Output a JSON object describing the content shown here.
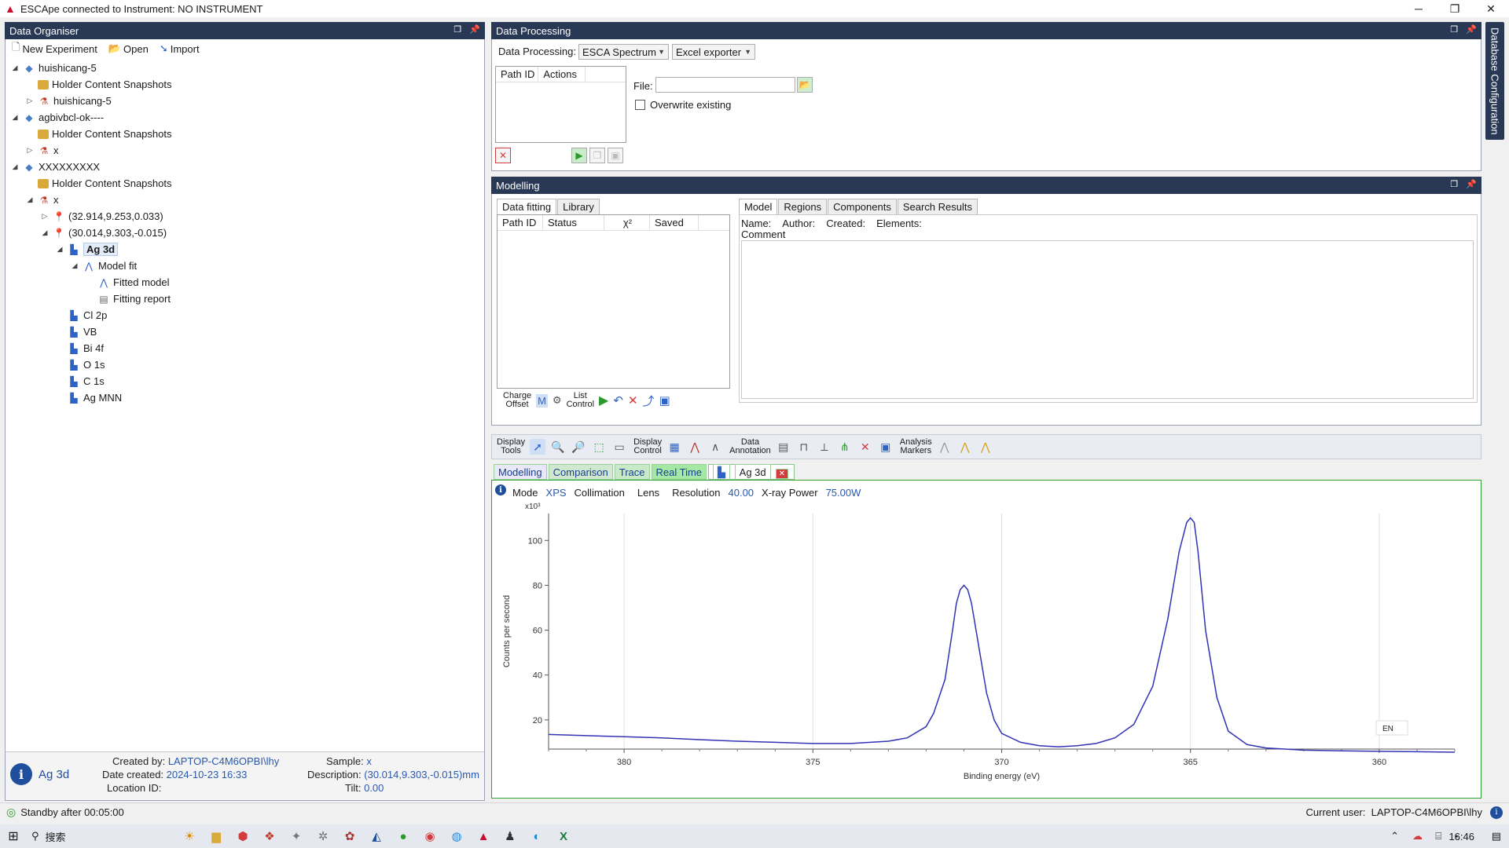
{
  "window": {
    "title": "ESCApe connected to Instrument: NO INSTRUMENT",
    "controls": [
      "minimize-icon",
      "restore-icon",
      "close-icon"
    ]
  },
  "organiser": {
    "title": "Data Organiser",
    "toolbar": {
      "new_experiment": "New Experiment",
      "open": "Open",
      "import": "Import"
    },
    "tree": [
      {
        "label": "huishicang-5",
        "level": 0,
        "toggle": "expanded",
        "icon": "experiment-icon"
      },
      {
        "label": "Holder Content Snapshots",
        "level": 1,
        "toggle": "none",
        "icon": "folder-icon"
      },
      {
        "label": "huishicang-5",
        "level": 1,
        "toggle": "collapsed",
        "icon": "sample-icon"
      },
      {
        "label": "agbivbcl-ok----",
        "level": 0,
        "toggle": "expanded",
        "icon": "experiment-icon"
      },
      {
        "label": "Holder Content Snapshots",
        "level": 1,
        "toggle": "none",
        "icon": "folder-icon"
      },
      {
        "label": "x",
        "level": 1,
        "toggle": "collapsed",
        "icon": "sample-icon"
      },
      {
        "label": "XXXXXXXXX",
        "level": 0,
        "toggle": "expanded",
        "icon": "experiment-icon"
      },
      {
        "label": "Holder Content Snapshots",
        "level": 1,
        "toggle": "none",
        "icon": "folder-icon"
      },
      {
        "label": "x",
        "level": 1,
        "toggle": "expanded",
        "icon": "sample-icon"
      },
      {
        "label": "(32.914,9.253,0.033)",
        "level": 2,
        "toggle": "collapsed",
        "icon": "point-icon"
      },
      {
        "label": "(30.014,9.303,-0.015)",
        "level": 2,
        "toggle": "expanded",
        "icon": "point-icon"
      },
      {
        "label": "Ag 3d",
        "level": 3,
        "toggle": "expanded",
        "icon": "spectrum-icon",
        "selected": true
      },
      {
        "label": "Model fit",
        "level": 4,
        "toggle": "expanded",
        "icon": "model-icon"
      },
      {
        "label": "Fitted model",
        "level": 5,
        "toggle": "none",
        "icon": "fitted-model-icon"
      },
      {
        "label": "Fitting report",
        "level": 5,
        "toggle": "none",
        "icon": "report-icon"
      },
      {
        "label": "Cl 2p",
        "level": 3,
        "toggle": "none",
        "icon": "spectrum-icon"
      },
      {
        "label": "VB",
        "level": 3,
        "toggle": "none",
        "icon": "spectrum-icon"
      },
      {
        "label": "Bi 4f",
        "level": 3,
        "toggle": "none",
        "icon": "spectrum-icon"
      },
      {
        "label": "O 1s",
        "level": 3,
        "toggle": "none",
        "icon": "spectrum-icon"
      },
      {
        "label": "C 1s",
        "level": 3,
        "toggle": "none",
        "icon": "spectrum-icon"
      },
      {
        "label": "Ag MNN",
        "level": 3,
        "toggle": "none",
        "icon": "spectrum-icon"
      }
    ],
    "info": {
      "name": "Ag 3d",
      "created_by_label": "Created by:",
      "created_by": "LAPTOP-C4M6OPBI\\lhy",
      "date_label": "Date created:",
      "date": "2024-10-23 16:33",
      "location_label": "Location ID:",
      "location": "",
      "sample_label": "Sample:",
      "sample": "x",
      "description_label": "Description:",
      "description": "(30.014,9.303,-0.015)mm",
      "tilt_label": "Tilt:",
      "tilt": "0.00"
    }
  },
  "processing": {
    "title": "Data Processing",
    "label": "Data Processing:",
    "type_value": "ESCA Spectrum",
    "exporter_value": "Excel exporter",
    "list_headers": [
      "Path ID",
      "Actions"
    ],
    "file_label": "File:",
    "file_value": "",
    "overwrite_label": "Overwrite existing"
  },
  "side_tab": "Database Configuration",
  "modelling": {
    "title": "Modelling",
    "left_tabs": [
      "Data fitting",
      "Library"
    ],
    "table_headers": [
      "Path ID",
      "Status",
      "χ²",
      "Saved"
    ],
    "toolbar": {
      "charge_offset_1": "Charge",
      "charge_offset_2": "Offset",
      "list_control_1": "List",
      "list_control_2": "Control"
    },
    "right_tabs": [
      "Model",
      "Regions",
      "Components",
      "Search Results"
    ],
    "fields": {
      "name": "Name:",
      "author": "Author:",
      "created": "Created:",
      "elements": "Elements:",
      "comment": "Comment"
    }
  },
  "display_toolbar": {
    "display_tools_1": "Display",
    "display_tools_2": "Tools",
    "display_control_1": "Display",
    "display_control_2": "Control",
    "data_annotation_1": "Data",
    "data_annotation_2": "Annotation",
    "analysis_markers_1": "Analysis",
    "analysis_markers_2": "Markers"
  },
  "view_tabs": {
    "modelling": "Modelling",
    "comparison": "Comparison",
    "trace": "Trace",
    "realtime": "Real Time",
    "spectrum": "Ag 3d"
  },
  "spectrum_meta": {
    "mode_label": "Mode",
    "mode": "XPS",
    "collimation_label": "Collimation",
    "lens_label": "Lens",
    "resolution_label": "Resolution",
    "resolution": "40.00",
    "xray_label": "X-ray Power",
    "xray": "75.00W"
  },
  "chart_data": {
    "type": "line",
    "xlabel": "Binding energy (eV)",
    "ylabel": "Counts per second",
    "y_multiplier": "x10³",
    "xlim": [
      382,
      358
    ],
    "ylim": [
      7,
      112
    ],
    "x_reversed": true,
    "xticks": [
      380,
      375,
      370,
      365,
      360
    ],
    "yticks": [
      20,
      40,
      60,
      80,
      100
    ],
    "grid": "vertical",
    "series": [
      {
        "color": "#3232b4",
        "x": [
          382,
          381,
          380,
          379,
          378,
          377,
          376,
          375,
          374,
          373,
          372.5,
          372,
          371.8,
          371.5,
          371.3,
          371.2,
          371.1,
          371,
          370.9,
          370.8,
          370.6,
          370.4,
          370.2,
          370,
          369.5,
          369,
          368.5,
          368,
          367.5,
          367,
          366.5,
          366,
          365.6,
          365.3,
          365.1,
          365,
          364.9,
          364.8,
          364.6,
          364.3,
          364,
          363.5,
          363,
          362,
          361,
          360,
          359,
          358
        ],
        "y": [
          13.5,
          13.0,
          12.5,
          12.0,
          11.2,
          10.5,
          10.0,
          9.5,
          9.5,
          10.5,
          12,
          17,
          23,
          38,
          60,
          72,
          78,
          80,
          78,
          72,
          52,
          32,
          20,
          14,
          10,
          8.5,
          8,
          8.5,
          9.5,
          12,
          18,
          35,
          65,
          95,
          108,
          110,
          108,
          95,
          60,
          30,
          15,
          9,
          7.5,
          6.5,
          6.2,
          6.0,
          5.8,
          5.6
        ]
      }
    ],
    "legend_box": "EN"
  },
  "statusbar": {
    "standby": "Standby after 00:05:00",
    "user_label": "Current user:",
    "user": "LAPTOP-C4M6OPBI\\lhy"
  },
  "taskbar": {
    "search_placeholder": "搜索",
    "time": "16:46"
  }
}
